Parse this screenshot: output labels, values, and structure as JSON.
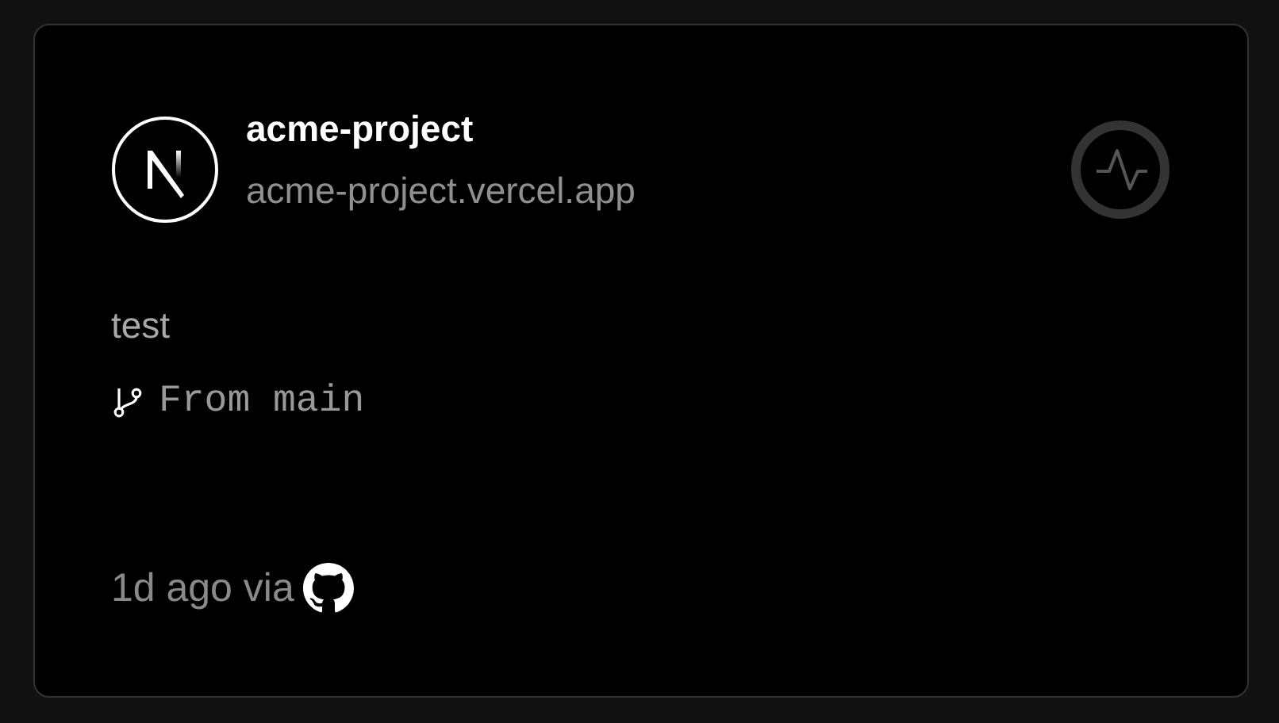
{
  "project": {
    "name": "acme-project",
    "url": "acme-project.vercel.app"
  },
  "deployment": {
    "message": "test",
    "branch": "From main",
    "time": "1d ago via"
  }
}
